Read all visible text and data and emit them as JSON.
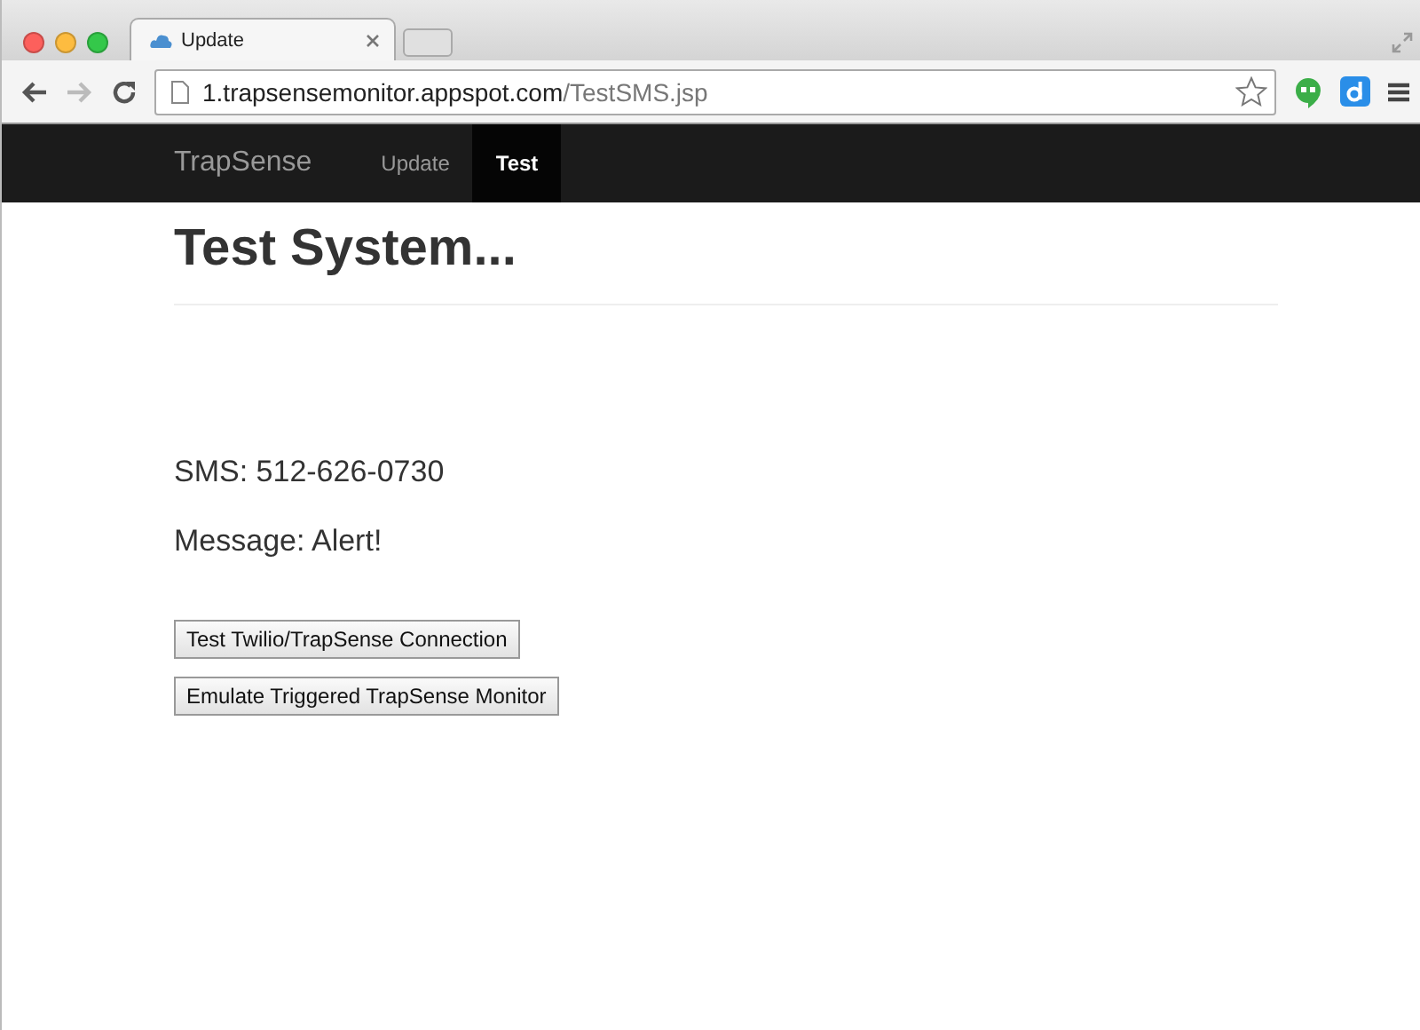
{
  "browser": {
    "tabs": [
      {
        "title": "Update",
        "selected": true
      }
    ],
    "url_host": "1.trapsensemonitor.appspot.com",
    "url_path": "/TestSMS.jsp"
  },
  "navbar": {
    "brand": "TrapSense",
    "items": [
      {
        "label": "Update",
        "selected": false
      },
      {
        "label": "Test",
        "selected": true
      }
    ]
  },
  "page": {
    "heading": "Test System...",
    "lines": [
      "SMS: 512-626-0730",
      "Message: Alert!"
    ],
    "buttons": [
      "Test Twilio/TrapSense Connection",
      "Emulate Triggered TrapSense Monitor"
    ]
  }
}
